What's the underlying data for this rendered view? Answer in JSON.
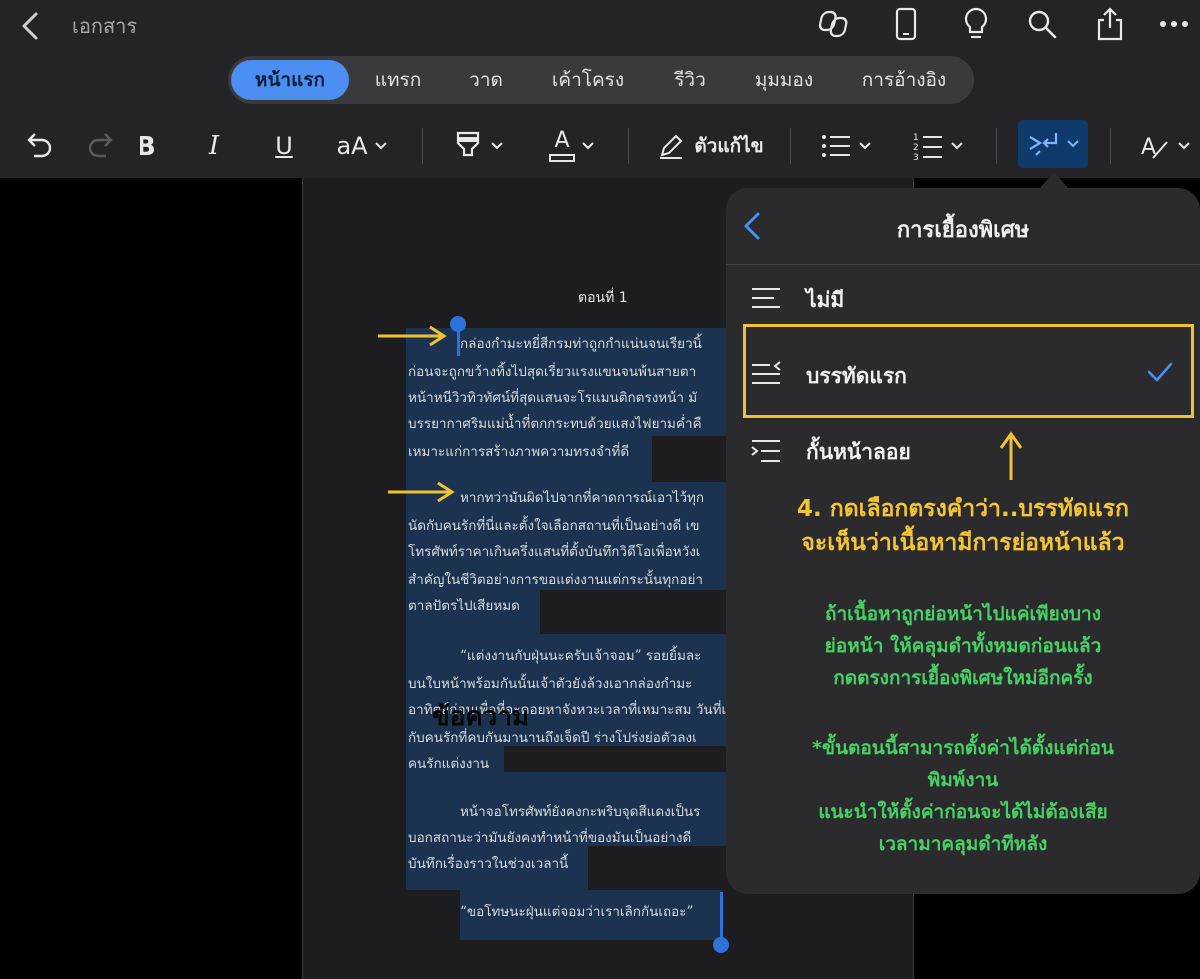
{
  "header": {
    "back_icon": "chevron-left-icon",
    "title": "เอกสาร",
    "icons": [
      "copilot-icon",
      "phone-icon",
      "lightbulb-icon",
      "search-icon",
      "share-icon",
      "more-icon"
    ]
  },
  "tabs": [
    {
      "label": "หน้าแรก",
      "active": true
    },
    {
      "label": "แทรก",
      "active": false
    },
    {
      "label": "วาด",
      "active": false
    },
    {
      "label": "เค้าโครง",
      "active": false
    },
    {
      "label": "รีวิว",
      "active": false
    },
    {
      "label": "มุมมอง",
      "active": false
    },
    {
      "label": "การอ้างอิง",
      "active": false
    }
  ],
  "toolbar": {
    "undo": "undo-icon",
    "redo": "redo-icon",
    "bold": "bold-icon",
    "italic": "I",
    "underline": "U",
    "font_size": "aA",
    "highlighter": "highlighter-icon",
    "font_color": "A",
    "editor_label": "ตัวแก้ไข",
    "bullets": "bullet-list-icon",
    "numbering": "numbered-list-icon",
    "special_indent": "indent-icon",
    "styles": "styles-icon"
  },
  "document": {
    "chapter_title": "ตอนที่ 1",
    "lines": [
      "กล่องกำมะหยี่สีกรมท่าถูกกำแน่นจนเรียวนิ้",
      "ก่อนจะถูกขว้างทิ้งไปสุดเรี่ยวแรงแขนจนพ้นสายตา",
      "หน้าหนีวิวทิวทัศน์ที่สุดแสนจะโรแมนติกตรงหน้า มั",
      "บรรยากาศริมแม่น้ำที่ตกกระทบด้วยแสงไฟยามค่ำคื",
      "เหมาะแก่การสร้างภาพความทรงจำที่ดี",
      "หากทว่ามันผิดไปจากที่คาดการณ์เอาไว้ทุก",
      "นัดกับคนรักที่นี่และตั้งใจเลือกสถานที่เป็นอย่างดี เข",
      "โทรศัพท์ราคาเกินครึ่งแสนที่ตั้งบันทึกวิดีโอเพื่อหวังเ",
      "สำคัญในชีวิตอย่างการขอแต่งงานแต่กระนั้นทุกอย่า",
      "ตาลปัตรไปเสียหมด",
      "“แต่งงานกับฝุ่นนะครับเจ้าจอม” รอยยิ้มละ",
      "บนใบหน้าพร้อมกันนั้นเจ้าตัวยังล้วงเอากล่องกำมะ",
      "อาทิตย์ก่อนเพื่อที่จะคอยหาจังหวะเวลาที่เหมาะสม วันที่เร",
      "กับคนรักที่คบกันมานานถึงเจ็ดปี ร่างโปร่งย่อตัวลงเ",
      "คนรักแต่งงาน",
      "หน้าจอโทรศัพท์ยังคงกะพริบจุดสีแดงเป็นร",
      "บอกสถานะว่ามันยังคงทำหน้าที่ของมันเป็นอย่างดี",
      "บันทึกเรื่องราวในช่วงเวลานี้",
      "“ขอโทษนะฝุ่นแต่จอมว่าเราเลิกกันเถอะ”"
    ],
    "overlay_heading": "ข้อความ"
  },
  "popover": {
    "title": "การเยื้องพิเศษ",
    "back_icon": "chevron-left-icon",
    "options": [
      {
        "label": "ไม่มี",
        "icon": "no-indent-icon",
        "selected": false
      },
      {
        "label": "บรรทัดแรก",
        "icon": "first-line-indent-icon",
        "selected": true
      },
      {
        "label": "กั้นหน้าลอย",
        "icon": "hanging-indent-icon",
        "selected": false
      }
    ]
  },
  "annotations": {
    "step_line1": "4. กดเลือกตรงคำว่า..บรรทัดแรก",
    "step_line2": "จะเห็นว่าเนื้อหามีการย่อหน้าแล้ว",
    "tip_lines": [
      "ถ้าเนื้อหาถูกย่อหน้าไปแค่เพียงบาง",
      "ย่อหน้า  ให้คลุมดำทั้งหมดก่อนแล้ว",
      "กดตรงการเยื้องพิเศษใหม่อีกครั้ง"
    ],
    "note_lines": [
      "*ขั้นตอนนี้สามารถตั้งค่าได้ตั้งแต่ก่อน",
      "พิมพ์งาน",
      "แนะนำให้ตั้งค่าก่อนจะได้ไม่ต้องเสีย",
      "เวลามาคลุมดำทีหลัง"
    ]
  },
  "colors": {
    "accent_blue": "#4a8ff1",
    "annotation_yellow": "#f5c431",
    "annotation_green": "#45d163",
    "selection": "#1b3350"
  }
}
